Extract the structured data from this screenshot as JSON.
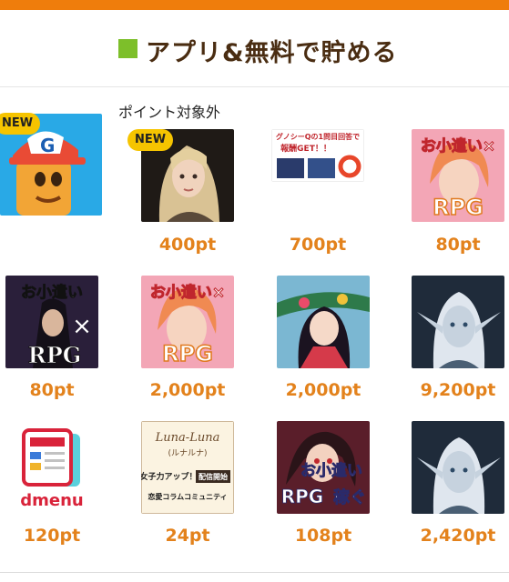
{
  "header": {
    "title": "アプリ&無料で貯める"
  },
  "section_label": "ポイント対象外",
  "badge_new": "NEW",
  "apps": [
    {
      "name": "guide-character-app"
    },
    {
      "name": "fantasy-girl-game",
      "points": "400pt"
    },
    {
      "name": "gunosy-quiz-ad",
      "points": "700pt",
      "banner_text": "グノシーQの1問目回答で",
      "banner_text2": "報酬GET！！"
    },
    {
      "name": "okozukai-rpg-1",
      "points": "80pt",
      "line1": "お小遣い×",
      "line2": "RPG"
    },
    {
      "name": "okozukai-rpg-dark",
      "points": "80pt",
      "line1": "お小遣い",
      "line2": "×",
      "line3": "RPG"
    },
    {
      "name": "okozukai-rpg-2",
      "points": "2,000pt",
      "line1": "お小遣い×",
      "line2": "RPG"
    },
    {
      "name": "shrine-girl-game",
      "points": "2,000pt"
    },
    {
      "name": "elf-game-1",
      "points": "9,200pt"
    },
    {
      "name": "dmenu",
      "points": "120pt",
      "logo_text": "dmenu"
    },
    {
      "name": "luna-luna",
      "points": "24pt",
      "line1": "Luna-Luna",
      "line2": "(ルナルナ)",
      "line3": "女子力アップ！",
      "badge": "配信開始",
      "line4": "恋愛コラムコミュニティ"
    },
    {
      "name": "okozukai-rpg-kasegu",
      "points": "108pt",
      "line1": "お小遣い",
      "line2": "RPG",
      "line3": "稼ぐ"
    },
    {
      "name": "elf-game-2",
      "points": "2,420pt"
    }
  ]
}
